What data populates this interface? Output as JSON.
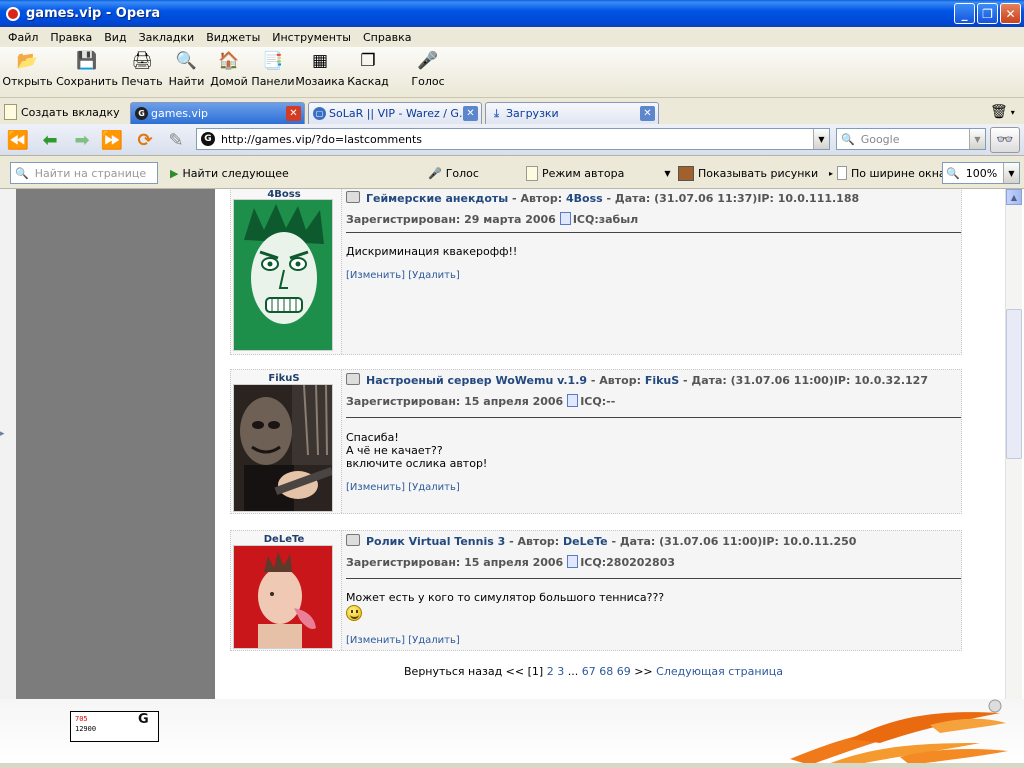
{
  "window": {
    "title": "games.vip - Opera"
  },
  "menu": [
    "Файл",
    "Правка",
    "Вид",
    "Закладки",
    "Виджеты",
    "Инструменты",
    "Справка"
  ],
  "toolbar": [
    {
      "label": "Открыть",
      "icon": "folder-icon"
    },
    {
      "label": "Сохранить",
      "icon": "save-icon"
    },
    {
      "label": "Печать",
      "icon": "print-icon"
    },
    {
      "label": "Найти",
      "icon": "magnifier-icon"
    },
    {
      "label": "Домой",
      "icon": "home-icon"
    },
    {
      "label": "Панели",
      "icon": "panels-icon"
    },
    {
      "label": "Мозаика",
      "icon": "tile-icon"
    },
    {
      "label": "Каскад",
      "icon": "cascade-icon"
    },
    {
      "label": "Голос",
      "icon": "voice-icon"
    }
  ],
  "tabs": {
    "new_tab": "Создать вкладку",
    "items": [
      {
        "label": "games.vip",
        "active": true
      },
      {
        "label": "SoLaR || VIP - Warez / G...",
        "active": false
      },
      {
        "label": "Загрузки",
        "active": false
      }
    ]
  },
  "address": {
    "url": "http://games.vip/?do=lastcomments",
    "search_placeholder": "Google"
  },
  "findbar": {
    "placeholder": "Найти на странице",
    "find_next": "Найти следующее",
    "voice": "Голос",
    "author_mode": "Режим автора",
    "show_images": "Показывать рисунки",
    "fit_width": "По ширине окна",
    "zoom": "100%"
  },
  "posts": [
    {
      "nick": "4Boss",
      "title": "Геймерские анекдоты",
      "author_label": "- Автор:",
      "author": "4Boss",
      "date_ip": "- Дата: (31.07.06 11:37)IP: 10.0.111.188",
      "registered": "Зарегистрирован: 29 марта 2006",
      "icq": "ICQ:забыл",
      "message": "Дискриминация квакерофф!!",
      "edit": "[Изменить]",
      "delete": "[Удалить]"
    },
    {
      "nick": "FikuS",
      "title": "Настроеный сервер WoWemu v.1.9",
      "author_label": "- Автор:",
      "author": "FikuS",
      "date_ip": "- Дата: (31.07.06 11:00)IP: 10.0.32.127",
      "registered": "Зарегистрирован: 15 апреля 2006",
      "icq": "ICQ:--",
      "message": "Спасиба!\nА чё не качает??\nвключите ослика автор!",
      "edit": "[Изменить]",
      "delete": "[Удалить]"
    },
    {
      "nick": "DeLeTe",
      "title": "Ролик Virtual Tennis 3",
      "author_label": "- Автор:",
      "author": "DeLeTe",
      "date_ip": "- Дата: (31.07.06 11:00)IP: 10.0.11.250",
      "registered": "Зарегистрирован: 15 апреля 2006",
      "icq": "ICQ:280202803",
      "message": "Может есть у кого то симулятор большого тенниса???",
      "edit": "[Изменить]",
      "delete": "[Удалить]"
    }
  ],
  "pager": {
    "back": "Вернуться назад <<",
    "current": "[1]",
    "pages": [
      "2",
      "3"
    ],
    "ellipsis": "...",
    "tail_pages": [
      "67",
      "68",
      "69"
    ],
    "forward": ">>",
    "next": "Следующая страница"
  },
  "counter": {
    "line1": "705",
    "line2": "12900"
  },
  "colors": {
    "accent": "#23497f",
    "link": "#2d5a9c",
    "titlebar": "#0055e5"
  }
}
